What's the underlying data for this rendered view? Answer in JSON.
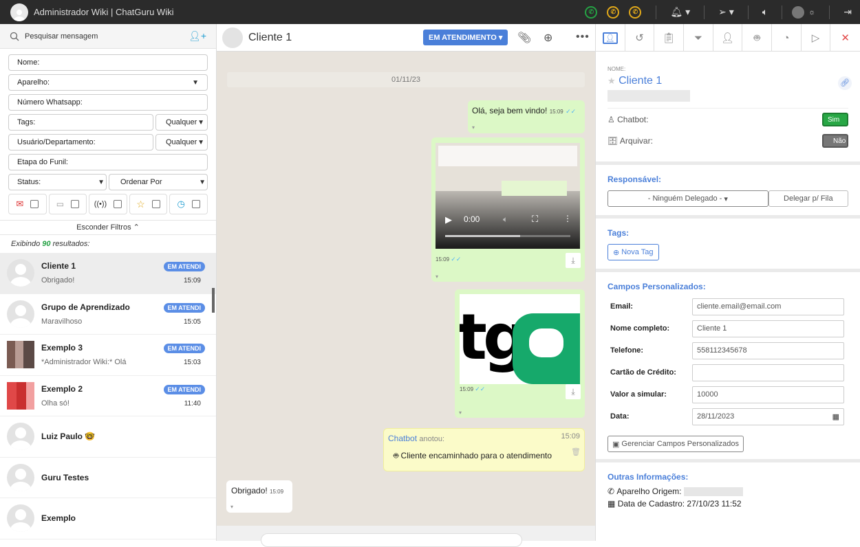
{
  "app": {
    "title": "Administrador Wiki | ChatGuru Wiki"
  },
  "left": {
    "search_placeholder": "Pesquisar mensagem",
    "filters": {
      "nome": "Nome:",
      "aparelho": "Aparelho:",
      "numero": "Número Whatsapp:",
      "tags": "Tags:",
      "tags_any": "Qualquer",
      "usuario": "Usuário/Departamento:",
      "usuario_any": "Qualquer",
      "etapa": "Etapa do Funil:",
      "status": "Status:",
      "ordenar": "Ordenar Por"
    },
    "hide_filters": "Esconder Filtros",
    "results_prefix": "Exibindo",
    "results_count": "90",
    "results_suffix": "resultados:",
    "chats": [
      {
        "name": "Cliente 1",
        "preview": "Obrigado!",
        "badge": "EM ATENDI",
        "time": "15:09"
      },
      {
        "name": "Grupo de Aprendizado",
        "preview": "Maravilhoso",
        "badge": "EM ATENDI",
        "time": "15:05"
      },
      {
        "name": "Exemplo 3",
        "preview": "*Administrador Wiki:* Olá",
        "badge": "EM ATENDI",
        "time": "15:03"
      },
      {
        "name": "Exemplo 2",
        "preview": "Olha só!",
        "badge": "EM ATENDI",
        "time": "11:40"
      },
      {
        "name": "Luiz Paulo 🤓",
        "preview": "",
        "badge": "",
        "time": ""
      },
      {
        "name": "Guru Testes",
        "preview": "",
        "badge": "",
        "time": ""
      },
      {
        "name": "Exemplo",
        "preview": "",
        "badge": "",
        "time": ""
      }
    ]
  },
  "chat": {
    "contact_name": "Cliente 1",
    "status_button": "EM ATENDIMENTO",
    "date": "01/11/23",
    "msg1": {
      "text": "Olá, seja bem vindo!",
      "time": "15:09"
    },
    "video": {
      "time_label": "0:00",
      "time": "15:09"
    },
    "image_msg": {
      "time": "15:09",
      "logo_text": "tg"
    },
    "chatbot": {
      "author": "Chatbot",
      "suffix": "anotou:",
      "time": "15:09",
      "text": "Cliente encaminhado para o atendimento"
    },
    "msg_in": {
      "text": "Obrigado!",
      "time": "15:09"
    }
  },
  "details": {
    "name_label": "NOME:",
    "name": "Cliente 1",
    "chatbot_label": "Chatbot:",
    "chatbot_value": "Sim",
    "archive_label": "Arquivar:",
    "archive_value": "Não",
    "responsavel_title": "Responsável:",
    "delegate_select": "- Ninguém Delegado -",
    "delegate_queue": "Delegar p/ Fila",
    "tags_title": "Tags:",
    "new_tag": "Nova Tag",
    "custom_title": "Campos Personalizados:",
    "fields": [
      {
        "key": "Email:",
        "value": "cliente.email@email.com"
      },
      {
        "key": "Nome completo:",
        "value": "Cliente 1"
      },
      {
        "key": "Telefone:",
        "value": "558112345678"
      },
      {
        "key": "Cartão de Crédito:",
        "value": ""
      },
      {
        "key": "Valor a simular:",
        "value": "10000"
      },
      {
        "key": "Data:",
        "value": "28/11/2023"
      }
    ],
    "manage_fields": "Gerenciar Campos Personalizados",
    "other_title": "Outras Informações:",
    "origin_label": "Aparelho Origem:",
    "created_label": "Data de Cadastro:",
    "created_value": "27/10/23 11:52"
  },
  "colors": {
    "accent": "#4a7fd9",
    "whatsapp_green": "#25a244",
    "whatsapp_yellow": "#e0a81a",
    "out_bubble": "#dcf8c6"
  }
}
